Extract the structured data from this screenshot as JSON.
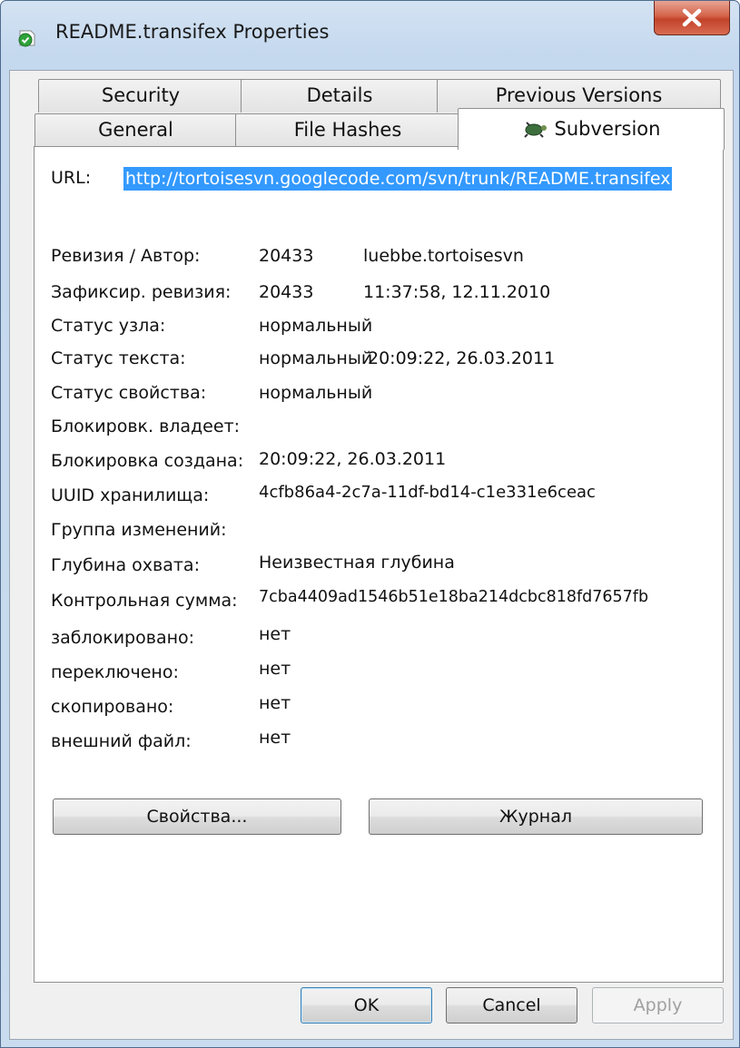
{
  "window": {
    "title": "README.transifex Properties"
  },
  "tabs_row1": [
    "Security",
    "Details",
    "Previous Versions"
  ],
  "tabs_row2": [
    "General",
    "File Hashes",
    "Subversion"
  ],
  "url": {
    "label": "URL:",
    "value": "http://tortoisesvn.googlecode.com/svn/trunk/README.transifex"
  },
  "props": [
    {
      "label": "Ревизия / Автор:",
      "value": "20433",
      "extra": "luebbe.tortoisesvn"
    },
    {
      "label": "Зафиксир. ревизия:",
      "value": "20433",
      "extra": "11:37:58, 12.11.2010"
    },
    {
      "label": "Статус узла:",
      "value": "нормальный",
      "extra": ""
    },
    {
      "label": "Статус текста:",
      "value": "нормальный",
      "extra": "20:09:22, 26.03.2011"
    },
    {
      "label": "Статус свойства:",
      "value": "нормальный",
      "extra": ""
    },
    {
      "label": "Блокировк. владеет:",
      "value": "",
      "extra": ""
    },
    {
      "label": "Блокировка создана:",
      "value": "20:09:22, 26.03.2011",
      "extra": ""
    },
    {
      "label": "UUID хранилища:",
      "value": "4cfb86a4-2c7a-11df-bd14-c1e331e6ceac",
      "extra": ""
    },
    {
      "label": "Группа изменений:",
      "value": "",
      "extra": ""
    },
    {
      "label": "Глубина охвата:",
      "value": "Неизвестная глубина",
      "extra": ""
    },
    {
      "label": "Контрольная сумма:",
      "value": "7cba4409ad1546b51e18ba214dcbc818fd7657fb",
      "extra": ""
    },
    {
      "label": "заблокировано:",
      "value": "нет",
      "extra": ""
    },
    {
      "label": "переключено:",
      "value": "нет",
      "extra": ""
    },
    {
      "label": "скопировано:",
      "value": "нет",
      "extra": ""
    },
    {
      "label": "внешний файл:",
      "value": "нет",
      "extra": ""
    }
  ],
  "buttons": {
    "properties": "Свойства...",
    "log": "Журнал",
    "ok": "OK",
    "cancel": "Cancel",
    "apply": "Apply"
  }
}
